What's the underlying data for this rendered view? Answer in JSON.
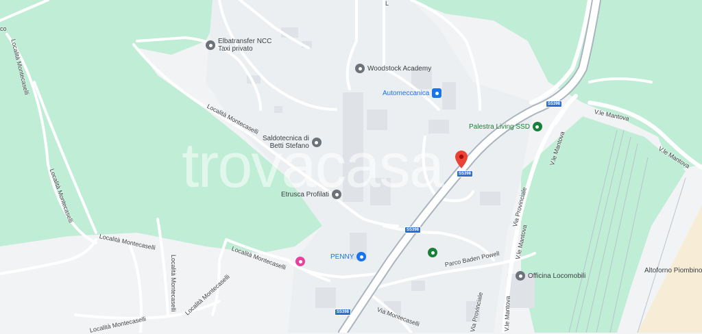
{
  "watermark": "trovacasa",
  "colors": {
    "park": "#bfedd6",
    "urban": "#f1f3f4",
    "road": "#ffffff",
    "highway": "#aab4bf",
    "poi_gray": "#6d7378",
    "poi_blue": "#1a73e8",
    "poi_green": "#188038",
    "poi_pink": "#e8429e",
    "pin_red": "#ea4335",
    "rail": "#b9c4ce"
  },
  "pois": [
    {
      "id": "elbatransfer",
      "lines": [
        "Elbatransfer NCC",
        "Taxi privato"
      ],
      "icon": "pin-gray-icon",
      "color": "#6d7378"
    },
    {
      "id": "woodstock",
      "lines": [
        "Woodstock Academy"
      ],
      "icon": "school-icon",
      "color": "#6d7378"
    },
    {
      "id": "automeccanica",
      "lines": [
        "Automeccanica"
      ],
      "icon": "lock-icon",
      "color": "#1a73e8"
    },
    {
      "id": "palestra",
      "lines": [
        "Palestra Living SSD"
      ],
      "icon": "gym-icon",
      "color": "#188038"
    },
    {
      "id": "saldotecnica",
      "lines": [
        "Saldotecnica di",
        "Betti Stefano"
      ],
      "icon": "pin-gray-icon",
      "color": "#6d7378"
    },
    {
      "id": "etrusca",
      "lines": [
        "Etrusca Profilati"
      ],
      "icon": "pin-gray-icon",
      "color": "#6d7378"
    },
    {
      "id": "penny",
      "lines": [
        "PENNY"
      ],
      "icon": "cart-icon",
      "color": "#1a73e8"
    },
    {
      "id": "dm",
      "lines": [
        ""
      ],
      "icon": "dm-store-icon",
      "color": "#e8429e"
    },
    {
      "id": "park",
      "lines": [
        ""
      ],
      "icon": "tree-icon",
      "color": "#188038"
    },
    {
      "id": "officina",
      "lines": [
        "Officina Locomobili"
      ],
      "icon": "pin-gray-icon",
      "color": "#6d7378"
    },
    {
      "id": "altoforno",
      "lines": [
        "Altoforno Piombino"
      ],
      "icon": "",
      "color": "#6d7378"
    }
  ],
  "streets": {
    "montecaselli_left": "Località Montecaselli",
    "montecaselli_top": "Località Montecaselli",
    "montecaselli_a": "Località Montecaselli",
    "montecaselli_b": "Località Montecaselli",
    "montecaselli_c": "Località Montecaselli",
    "montecaselli_d": "Località Montecaselli",
    "montecaselli_e": "Località Montecaselli",
    "via_montecaselli": "Via Montecaselli",
    "baden_powell": "Parco Baden Powell",
    "vle_mantova_1": "V.le Mantova",
    "vle_mantova_2": "V.le Mantova",
    "vle_mantova_3": "V.le Mantova",
    "vle_mantova_4": "V.le Mantova",
    "via_provinciale_1": "Via Provinciale",
    "via_provinciale_2": "Via Provinciale",
    "edge_co": "co",
    "edge_l": "L"
  },
  "shields": [
    "SS398",
    "SS398",
    "SS398",
    "SS398"
  ]
}
